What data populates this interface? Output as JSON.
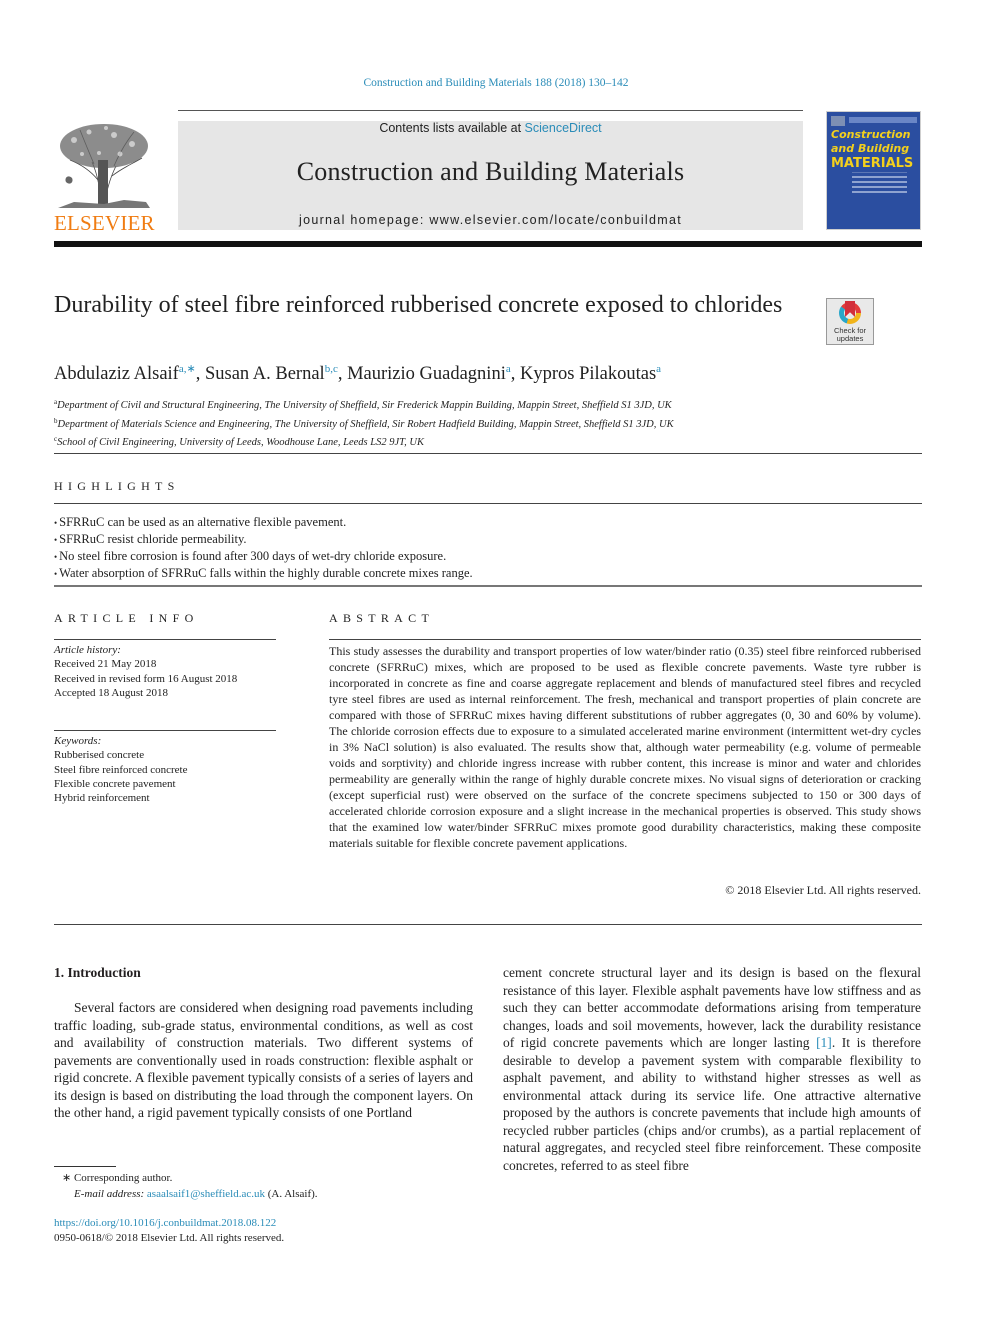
{
  "header": {
    "citation": "Construction and Building Materials 188 (2018) 130–142",
    "contents_prefix": "Contents lists available at ",
    "contents_link": "ScienceDirect",
    "journal_title": "Construction and Building Materials",
    "homepage": "journal homepage: www.elsevier.com/locate/conbuildmat",
    "publisher_logo_text": "ELSEVIER",
    "cover": {
      "line1": "Construction",
      "line2": "and Building",
      "line3": "MATERIALS"
    },
    "colors": {
      "link": "#2a8cb8",
      "elsevier_orange": "#f07c12",
      "cover_blue": "#2b4ea0",
      "cover_yellow": "#f4d01c"
    }
  },
  "article": {
    "title": "Durability of steel fibre reinforced rubberised concrete exposed to chlorides",
    "check_for_updates": {
      "line1": "Check for",
      "line2": "updates"
    },
    "authors": [
      {
        "name": "Abdulaziz Alsaif",
        "sup": "a,∗"
      },
      {
        "name": "Susan A. Bernal",
        "sup": "b,c"
      },
      {
        "name": "Maurizio Guadagnini",
        "sup": "a"
      },
      {
        "name": "Kypros Pilakoutas",
        "sup": "a"
      }
    ],
    "affiliations": [
      {
        "mark": "a",
        "text": "Department of Civil and Structural Engineering, The University of Sheffield, Sir Frederick Mappin Building, Mappin Street, Sheffield S1 3JD, UK"
      },
      {
        "mark": "b",
        "text": "Department of Materials Science and Engineering, The University of Sheffield, Sir Robert Hadfield Building, Mappin Street, Sheffield S1 3JD, UK"
      },
      {
        "mark": "c",
        "text": "School of Civil Engineering, University of Leeds, Woodhouse Lane, Leeds LS2 9JT, UK"
      }
    ]
  },
  "highlights": {
    "heading": "HIGHLIGHTS",
    "items": [
      "SFRRuC can be used as an alternative flexible pavement.",
      "SFRRuC resist chloride permeability.",
      "No steel fibre corrosion is found after 300 days of wet-dry chloride exposure.",
      "Water absorption of SFRRuC falls within the highly durable concrete mixes range."
    ]
  },
  "article_info": {
    "heading": "ARTICLE INFO",
    "history_label": "Article history:",
    "history": [
      "Received 21 May 2018",
      "Received in revised form 16 August 2018",
      "Accepted 18 August 2018"
    ],
    "keywords_label": "Keywords:",
    "keywords": [
      "Rubberised concrete",
      "Steel fibre reinforced concrete",
      "Flexible concrete pavement",
      "Hybrid reinforcement"
    ]
  },
  "abstract": {
    "heading": "ABSTRACT",
    "text": "This study assesses the durability and transport properties of low water/binder ratio (0.35) steel fibre reinforced rubberised concrete (SFRRuC) mixes, which are proposed to be used as flexible concrete pavements. Waste tyre rubber is incorporated in concrete as fine and coarse aggregate replacement and blends of manufactured steel fibres and recycled tyre steel fibres are used as internal reinforcement. The fresh, mechanical and transport properties of plain concrete are compared with those of SFRRuC mixes having different substitutions of rubber aggregates (0, 30 and 60% by volume). The chloride corrosion effects due to exposure to a simulated accelerated marine environment (intermittent wet-dry cycles in 3% NaCl solution) is also evaluated. The results show that, although water permeability (e.g. volume of permeable voids and sorptivity) and chloride ingress increase with rubber content, this increase is minor and water and chlorides permeability are generally within the range of highly durable concrete mixes. No visual signs of deterioration or cracking (except superficial rust) were observed on the surface of the concrete specimens subjected to 150 or 300 days of accelerated chloride corrosion exposure and a slight increase in the mechanical properties is observed. This study shows that the examined low water/binder SFRRuC mixes promote good durability characteristics, making these composite materials suitable for flexible concrete pavement applications.",
    "copyright": "© 2018 Elsevier Ltd. All rights reserved."
  },
  "introduction": {
    "heading": "1. Introduction",
    "left_column": "Several factors are considered when designing road pavements including traffic loading, sub-grade status, environmental conditions, as well as cost and availability of construction materials. Two different systems of pavements are conventionally used in roads construction: flexible asphalt or rigid concrete. A flexible pavement typically consists of a series of layers and its design is based on distributing the load through the component layers. On the other hand, a rigid pavement typically consists of one Portland",
    "right_column_before_ref": "cement concrete structural layer and its design is based on the flexural resistance of this layer. Flexible asphalt pavements have low stiffness and as such they can better accommodate deformations arising from temperature changes, loads and soil movements, however, lack the durability resistance of rigid concrete pavements which are longer lasting ",
    "ref": "[1]",
    "right_column_after_ref": ". It is therefore desirable to develop a pavement system with comparable flexibility to asphalt pavement, and ability to withstand higher stresses as well as environmental attack during its service life. One attractive alternative proposed by the authors is concrete pavements that include high amounts of recycled rubber particles (chips and/or crumbs), as a partial replacement of natural aggregates, and recycled steel fibre reinforcement. These composite concretes, referred to as steel fibre"
  },
  "footnotes": {
    "corresponding_mark": "∗",
    "corresponding_text": "Corresponding author.",
    "email_label": "E-mail address:",
    "email": "asaalsaif1@sheffield.ac.uk",
    "email_suffix": " (A. Alsaif).",
    "doi": "https://doi.org/10.1016/j.conbuildmat.2018.08.122",
    "issn_line": "0950-0618/© 2018 Elsevier Ltd. All rights reserved."
  }
}
